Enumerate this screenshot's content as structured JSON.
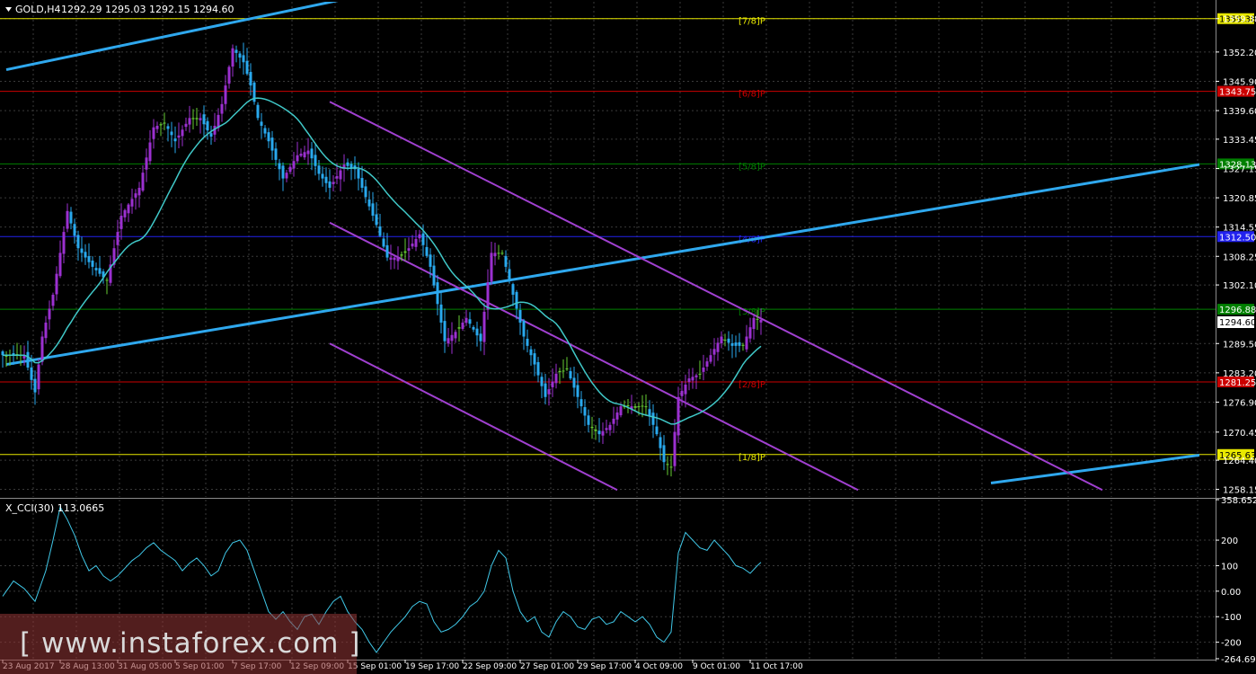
{
  "header": {
    "symbol": "GOLD,H4",
    "ohlc": "1292.29 1295.03 1292.15 1294.60"
  },
  "colors": {
    "background": "#000000",
    "grid": "#3a3a3a",
    "bull_candle": "#9b30d0",
    "bear_candle": "#29a9ee",
    "doji_candle": "#66cc33",
    "moving_average": "#40c8c8",
    "trend_line": "#2fa8ee",
    "channel_line": "#a040d0",
    "cci_line": "#40c8e8",
    "murrey_yellow": "#e8e800",
    "murrey_red": "#cc0000",
    "murrey_green": "#008000",
    "murrey_blue": "#2222ee"
  },
  "chart_data": [
    {
      "type": "candlestick",
      "ylim": [
        1256.5,
        1363.0
      ],
      "price_axis_ticks": [
        1359.38,
        1352.2,
        1345.9,
        1339.6,
        1333.45,
        1327.15,
        1320.85,
        1314.55,
        1308.25,
        1302.1,
        1289.5,
        1283.2,
        1276.9,
        1270.45,
        1264.4,
        1258.15
      ],
      "current_price": "1294.60",
      "murrey_levels": [
        {
          "label": "[7/8]P",
          "price": 1359.38,
          "tag": "1359.38",
          "color": "#e8e800"
        },
        {
          "label": "[6/8]P",
          "price": 1343.75,
          "tag": "1343.75",
          "color": "#cc0000"
        },
        {
          "label": "[5/8]P",
          "price": 1328.13,
          "tag": "1328.13",
          "color": "#008000"
        },
        {
          "label": "[4/8]P",
          "price": 1312.5,
          "tag": "1312.50",
          "color": "#2222ee"
        },
        {
          "label": "[3/8]P",
          "price": 1296.88,
          "tag": "1296.88",
          "color": "#008000"
        },
        {
          "label": "[2/8]P",
          "price": 1281.25,
          "tag": "1281.25",
          "color": "#cc0000"
        },
        {
          "label": "[1/8]P",
          "price": 1265.63,
          "tag": "1265.63",
          "color": "#e8e800"
        }
      ],
      "x_ticks": [
        "23 Aug 2017",
        "28 Aug 13:00",
        "31 Aug 05:00",
        "5 Sep 01:00",
        "7 Sep 17:00",
        "12 Sep 09:00",
        "15 Sep 01:00",
        "19 Sep 17:00",
        "22 Sep 09:00",
        "27 Sep 01:00",
        "29 Sep 17:00",
        "4 Oct 09:00",
        "9 Oct 01:00",
        "11 Oct 17:00"
      ],
      "x_tick_index": [
        0,
        16,
        32,
        48,
        64,
        80,
        96,
        112,
        128,
        144,
        160,
        176,
        192,
        208
      ],
      "bar_count": 212,
      "path_anchors": [
        [
          0,
          1287
        ],
        [
          6,
          1287
        ],
        [
          9,
          1279
        ],
        [
          11,
          1291
        ],
        [
          14,
          1300
        ],
        [
          18,
          1318
        ],
        [
          21,
          1310
        ],
        [
          25,
          1306
        ],
        [
          29,
          1303
        ],
        [
          33,
          1317
        ],
        [
          38,
          1323
        ],
        [
          42,
          1336
        ],
        [
          45,
          1337
        ],
        [
          48,
          1333
        ],
        [
          52,
          1338
        ],
        [
          55,
          1338
        ],
        [
          58,
          1334
        ],
        [
          61,
          1341
        ],
        [
          64,
          1353
        ],
        [
          67,
          1350
        ],
        [
          69,
          1345
        ],
        [
          71,
          1338
        ],
        [
          74,
          1333
        ],
        [
          78,
          1325
        ],
        [
          82,
          1330
        ],
        [
          85,
          1331
        ],
        [
          88,
          1326
        ],
        [
          91,
          1323
        ],
        [
          95,
          1328
        ],
        [
          98,
          1327
        ],
        [
          101,
          1321
        ],
        [
          104,
          1315
        ],
        [
          107,
          1308
        ],
        [
          110,
          1308
        ],
        [
          113,
          1310
        ],
        [
          116,
          1313
        ],
        [
          119,
          1306
        ],
        [
          121,
          1298
        ],
        [
          123,
          1290
        ],
        [
          126,
          1292
        ],
        [
          129,
          1295
        ],
        [
          133,
          1290
        ],
        [
          136,
          1309
        ],
        [
          139,
          1309
        ],
        [
          142,
          1300
        ],
        [
          145,
          1291
        ],
        [
          148,
          1285
        ],
        [
          151,
          1278
        ],
        [
          154,
          1283
        ],
        [
          157,
          1284
        ],
        [
          160,
          1278
        ],
        [
          163,
          1272
        ],
        [
          166,
          1270
        ],
        [
          169,
          1272
        ],
        [
          172,
          1276
        ],
        [
          176,
          1276
        ],
        [
          179,
          1276
        ],
        [
          182,
          1270
        ],
        [
          184,
          1264
        ],
        [
          186,
          1263
        ],
        [
          188,
          1278
        ],
        [
          191,
          1282
        ],
        [
          194,
          1283
        ],
        [
          197,
          1287
        ],
        [
          200,
          1291
        ],
        [
          203,
          1289
        ],
        [
          206,
          1289
        ],
        [
          209,
          1295
        ],
        [
          211,
          1294.6
        ]
      ],
      "moving_average": {
        "period": 20
      },
      "trend_lines": [
        {
          "from": [
            1,
            1348.4
          ],
          "to": [
            130,
            1369.2
          ]
        },
        {
          "from": [
            1,
            1285.0
          ],
          "to": [
            333,
            1328.0
          ]
        },
        {
          "from": [
            275,
            1259.5
          ],
          "to": [
            333,
            1265.5
          ]
        }
      ],
      "channel_lines": [
        {
          "from": [
            91,
            1341.5
          ],
          "to": [
            306,
            1258.0
          ]
        },
        {
          "from": [
            91,
            1315.5
          ],
          "to": [
            238,
            1258.0
          ]
        },
        {
          "from": [
            91,
            1289.5
          ],
          "to": [
            171,
            1258.0
          ]
        }
      ]
    },
    {
      "type": "line",
      "title": "X_CCI(30) 113.0665",
      "ylim": [
        -264.6909,
        358.6528
      ],
      "axis_ticks": [
        "358.6528",
        "200",
        "100",
        "0.00",
        "-100",
        "-200",
        "-264.6909"
      ],
      "axis_tick_values": [
        358.6528,
        200,
        100,
        0,
        -100,
        -200,
        -264.6909
      ],
      "series": [
        {
          "anchors": [
            [
              0,
              -20
            ],
            [
              3,
              40
            ],
            [
              6,
              10
            ],
            [
              9,
              -40
            ],
            [
              12,
              80
            ],
            [
              14,
              200
            ],
            [
              16,
              330
            ],
            [
              18,
              280
            ],
            [
              20,
              220
            ],
            [
              22,
              140
            ],
            [
              24,
              80
            ],
            [
              26,
              100
            ],
            [
              28,
              60
            ],
            [
              30,
              40
            ],
            [
              32,
              60
            ],
            [
              34,
              90
            ],
            [
              36,
              120
            ],
            [
              38,
              140
            ],
            [
              40,
              170
            ],
            [
              42,
              190
            ],
            [
              44,
              160
            ],
            [
              46,
              140
            ],
            [
              48,
              120
            ],
            [
              50,
              80
            ],
            [
              52,
              110
            ],
            [
              54,
              130
            ],
            [
              56,
              100
            ],
            [
              58,
              60
            ],
            [
              60,
              80
            ],
            [
              62,
              150
            ],
            [
              64,
              190
            ],
            [
              66,
              200
            ],
            [
              68,
              160
            ],
            [
              70,
              80
            ],
            [
              72,
              0
            ],
            [
              74,
              -80
            ],
            [
              76,
              -110
            ],
            [
              78,
              -80
            ],
            [
              80,
              -120
            ],
            [
              82,
              -150
            ],
            [
              84,
              -100
            ],
            [
              86,
              -90
            ],
            [
              88,
              -130
            ],
            [
              90,
              -80
            ],
            [
              92,
              -40
            ],
            [
              94,
              -20
            ],
            [
              96,
              -80
            ],
            [
              98,
              -120
            ],
            [
              100,
              -150
            ],
            [
              102,
              -200
            ],
            [
              104,
              -240
            ],
            [
              106,
              -200
            ],
            [
              108,
              -160
            ],
            [
              110,
              -130
            ],
            [
              112,
              -100
            ],
            [
              114,
              -60
            ],
            [
              116,
              -40
            ],
            [
              118,
              -50
            ],
            [
              120,
              -120
            ],
            [
              122,
              -160
            ],
            [
              124,
              -150
            ],
            [
              126,
              -130
            ],
            [
              128,
              -100
            ],
            [
              130,
              -60
            ],
            [
              132,
              -40
            ],
            [
              134,
              0
            ],
            [
              136,
              100
            ],
            [
              138,
              160
            ],
            [
              140,
              130
            ],
            [
              142,
              0
            ],
            [
              144,
              -80
            ],
            [
              146,
              -120
            ],
            [
              148,
              -100
            ],
            [
              150,
              -160
            ],
            [
              152,
              -180
            ],
            [
              154,
              -120
            ],
            [
              156,
              -80
            ],
            [
              158,
              -100
            ],
            [
              160,
              -140
            ],
            [
              162,
              -150
            ],
            [
              164,
              -110
            ],
            [
              166,
              -100
            ],
            [
              168,
              -130
            ],
            [
              170,
              -120
            ],
            [
              172,
              -80
            ],
            [
              174,
              -100
            ],
            [
              176,
              -120
            ],
            [
              178,
              -100
            ],
            [
              180,
              -130
            ],
            [
              182,
              -180
            ],
            [
              184,
              -200
            ],
            [
              186,
              -160
            ],
            [
              188,
              150
            ],
            [
              190,
              230
            ],
            [
              192,
              200
            ],
            [
              194,
              170
            ],
            [
              196,
              160
            ],
            [
              198,
              200
            ],
            [
              200,
              170
            ],
            [
              202,
              140
            ],
            [
              204,
              100
            ],
            [
              206,
              90
            ],
            [
              208,
              70
            ],
            [
              210,
              100
            ],
            [
              211,
              113
            ]
          ]
        }
      ]
    }
  ],
  "watermark": {
    "text": "[ www.instaforex.com ]"
  }
}
